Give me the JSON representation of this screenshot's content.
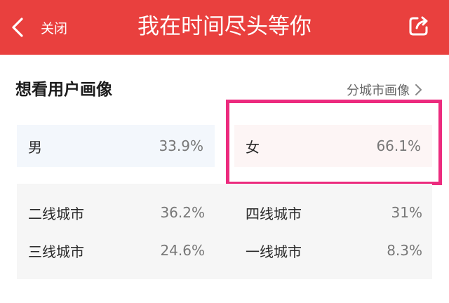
{
  "header": {
    "close_label": "关闭",
    "title": "我在时间尽头等你",
    "bar_color": "#e9403e"
  },
  "section": {
    "title": "想看用户画像",
    "city_link_label": "分城市画像"
  },
  "gender": [
    {
      "label": "男",
      "value": "33.9%"
    },
    {
      "label": "女",
      "value": "66.1%"
    }
  ],
  "cities": [
    {
      "label": "二线城市",
      "value": "36.2%"
    },
    {
      "label": "四线城市",
      "value": "31%"
    },
    {
      "label": "三线城市",
      "value": "24.6%"
    },
    {
      "label": "一线城市",
      "value": "8.3%"
    }
  ],
  "highlight_color": "#ec2b7e",
  "icons": [
    "chevron-left-icon",
    "share-icon",
    "chevron-right-icon"
  ]
}
